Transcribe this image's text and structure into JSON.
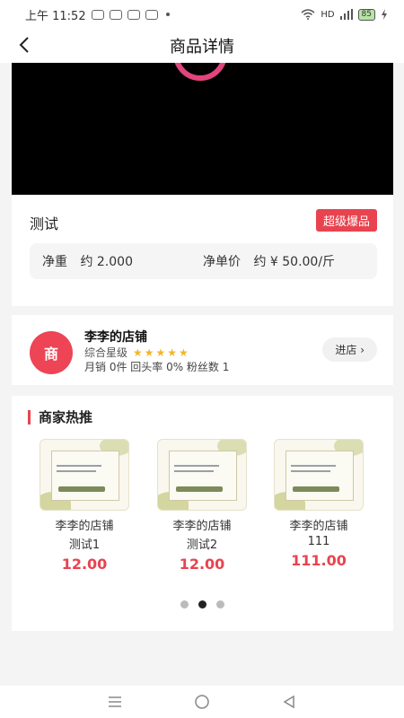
{
  "status": {
    "time": "上午 11:52",
    "network": "HD",
    "battery": "85"
  },
  "nav": {
    "title": "商品详情"
  },
  "product": {
    "name": "测试",
    "badge": "超级爆品",
    "weight_label": "净重",
    "weight_value": "约 2.000",
    "unit_price_label": "净单价",
    "unit_price_value": "约 ¥ 50.00/斤"
  },
  "store": {
    "avatar_text": "商",
    "name": "李李的店铺",
    "rating_label": "综合星级",
    "stars": "★★★★★",
    "stats": "月销 0件 回头率 0% 粉丝数 1",
    "enter_label": "进店 ›"
  },
  "recommend": {
    "title": "商家热推",
    "items": [
      {
        "shop": "李李的店铺",
        "name": "测试1",
        "price": "12.00"
      },
      {
        "shop": "李李的店铺",
        "name": "测试2",
        "price": "12.00"
      },
      {
        "shop": "李李的店铺",
        "name": "111",
        "price": "111.00"
      }
    ],
    "pages": 3,
    "active_page": 2
  },
  "colors": {
    "accent": "#e8434f",
    "star": "#f3b62a"
  }
}
